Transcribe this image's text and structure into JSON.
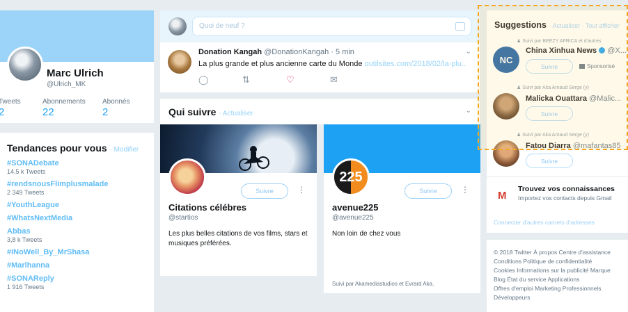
{
  "profile": {
    "name": "Marc Ulrich",
    "handle": "@Ulrich_MK",
    "stats": [
      {
        "label": "Tweets",
        "value": "2"
      },
      {
        "label": "Abonnements",
        "value": "22"
      },
      {
        "label": "Abonnés",
        "value": "2"
      }
    ]
  },
  "trends": {
    "title": "Tendances pour vous",
    "change": "· Modifier",
    "items": [
      {
        "name": "#SONADebate",
        "count": "14,5 k Tweets"
      },
      {
        "name": "#rendsnousFlimplusmalade",
        "count": "2 349 Tweets"
      },
      {
        "name": "#YouthLeague",
        "count": ""
      },
      {
        "name": "#WhatsNextMedia",
        "count": ""
      },
      {
        "name": "Abbas",
        "count": "3,8 k Tweets"
      },
      {
        "name": "#INoWell_By_MrShasa",
        "count": ""
      },
      {
        "name": "#Marlhanna",
        "count": ""
      },
      {
        "name": "#SONAReply",
        "count": "1 916 Tweets"
      }
    ]
  },
  "compose": {
    "placeholder": "Quoi de neuf ?"
  },
  "tweet": {
    "author": "Donation Kangah",
    "handle": "@DonationKangah · 5 min",
    "text": "La plus grande et plus ancienne carte du Monde",
    "link": "outilsites.com/2018/02/la-plu..."
  },
  "who_to_follow": {
    "title": "Qui suivre",
    "refresh": "· Actualiser",
    "cards": [
      {
        "name": "Citations célébres",
        "handle": "@startios",
        "bio": "Les plus belles citations de vos films, stars et musiques préférées.",
        "follow": "Suivre",
        "avatar_text": "",
        "followed_by": ""
      },
      {
        "name": "avenue225",
        "handle": "@avenue225",
        "bio": "Non loin de chez vous",
        "follow": "Suivre",
        "avatar_text": "225",
        "followed_by": "Suivi par Akamediastudios et Evrard Aka."
      }
    ]
  },
  "suggestions": {
    "title": "Suggestions",
    "actions": "· Actualiser · Tout afficher",
    "items": [
      {
        "context": "Suivi par BEEZY AFRICA et d'autres",
        "name": "China Xinhua News",
        "handle": "@X...",
        "button": "Suivre",
        "sponsored": "Sponsorisé",
        "verified": true
      },
      {
        "context": "Suivi par Aka Arnaud Serge (y)",
        "name": "Malicka Ouattara",
        "handle": "@Malic...",
        "button": "Suivre",
        "sponsored": "",
        "verified": false
      },
      {
        "context": "Suivi par Aka Arnaud Serge (y)",
        "name": "Fatou Diarra",
        "handle": "@mafantas85",
        "button": "Suivre",
        "sponsored": "",
        "verified": false
      }
    ]
  },
  "contacts": {
    "title": "Trouvez vos connaissances",
    "subtitle": "Importez vos contacts depuis Gmail",
    "link": "Connecter d'autres carnets d'adresses"
  },
  "footer": {
    "lines": [
      "© 2018 Twitter  À propos  Centre d'assistance",
      "Conditions  Politique de confidentialité",
      "Cookies  Informations sur la publicité  Marque",
      "Blog  État du service  Applications",
      "Offres d'emploi  Marketing  Professionnels",
      "Développeurs"
    ]
  },
  "colors": {
    "accent": "#1da1f2",
    "background": "#e6ecf0",
    "highlight": "#f5a623"
  }
}
